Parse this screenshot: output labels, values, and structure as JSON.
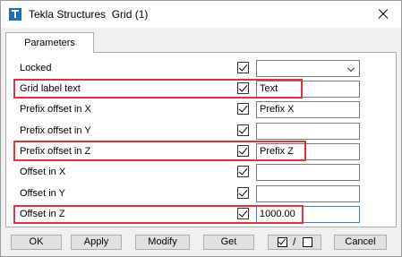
{
  "window": {
    "title": "Tekla Structures  Grid (1)"
  },
  "tabs": [
    {
      "label": "Parameters"
    }
  ],
  "rows": [
    {
      "label": "Locked",
      "value": "",
      "checked": true,
      "control": "combo"
    },
    {
      "label": "Grid label text",
      "value": "Text",
      "checked": true,
      "control": "text",
      "highlighted": true
    },
    {
      "label": "Prefix offset in X",
      "value": "Prefix X",
      "checked": true,
      "control": "text"
    },
    {
      "label": "Prefix offset in Y",
      "value": "",
      "checked": true,
      "control": "text"
    },
    {
      "label": "Prefix offset in Z",
      "value": "Prefix Z",
      "checked": true,
      "control": "text",
      "highlighted": true
    },
    {
      "label": "Offset in X",
      "value": "",
      "checked": true,
      "control": "text"
    },
    {
      "label": "Offset in Y",
      "value": "",
      "checked": true,
      "control": "text"
    },
    {
      "label": "Offset in Z",
      "value": "1000.00",
      "checked": true,
      "control": "text",
      "highlighted": true,
      "focused": true
    }
  ],
  "buttons": {
    "ok": "OK",
    "apply": "Apply",
    "modify": "Modify",
    "get": "Get",
    "toggle_separator": "/",
    "cancel": "Cancel"
  },
  "colors": {
    "highlight": "#e0323c",
    "focus_border": "#3c7fd1"
  }
}
